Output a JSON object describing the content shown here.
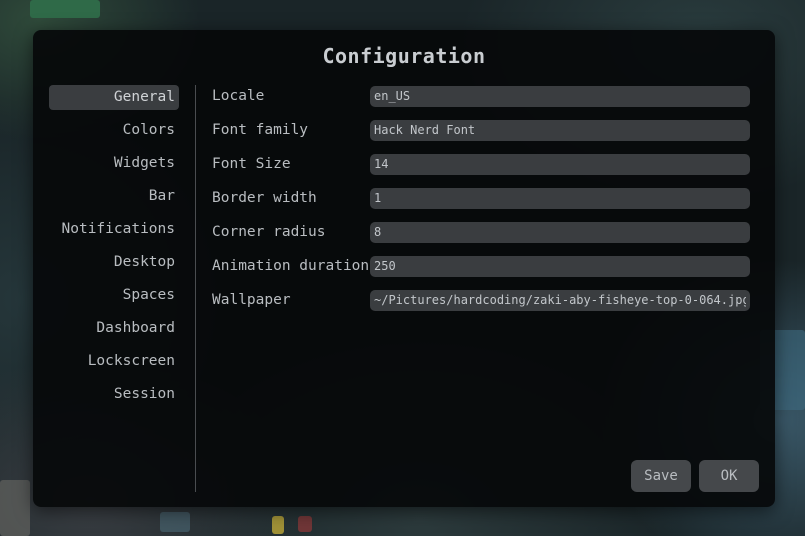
{
  "dialog": {
    "title": "Configuration"
  },
  "sidebar": {
    "items": [
      {
        "label": "General",
        "active": true
      },
      {
        "label": "Colors",
        "active": false
      },
      {
        "label": "Widgets",
        "active": false
      },
      {
        "label": "Bar",
        "active": false
      },
      {
        "label": "Notifications",
        "active": false
      },
      {
        "label": "Desktop",
        "active": false
      },
      {
        "label": "Spaces",
        "active": false
      },
      {
        "label": "Dashboard",
        "active": false
      },
      {
        "label": "Lockscreen",
        "active": false
      },
      {
        "label": "Session",
        "active": false
      }
    ]
  },
  "general": {
    "fields": [
      {
        "label": "Locale",
        "value": "en_US"
      },
      {
        "label": "Font family",
        "value": "Hack Nerd Font"
      },
      {
        "label": "Font Size",
        "value": "14"
      },
      {
        "label": "Border width",
        "value": "1"
      },
      {
        "label": "Corner radius",
        "value": "8"
      },
      {
        "label": "Animation duration",
        "value": "250"
      },
      {
        "label": "Wallpaper",
        "value": "~/Pictures/hardcoding/zaki-aby-fisheye-top-0-064.jpg"
      }
    ]
  },
  "buttons": {
    "save": "Save",
    "ok": "OK"
  },
  "colors": {
    "dialog_bg": "#06090a",
    "field_bg": "#3a3d40",
    "button_bg": "#45484b",
    "text": "#b9bdc1",
    "wallpaper_base": "#1a2528"
  }
}
